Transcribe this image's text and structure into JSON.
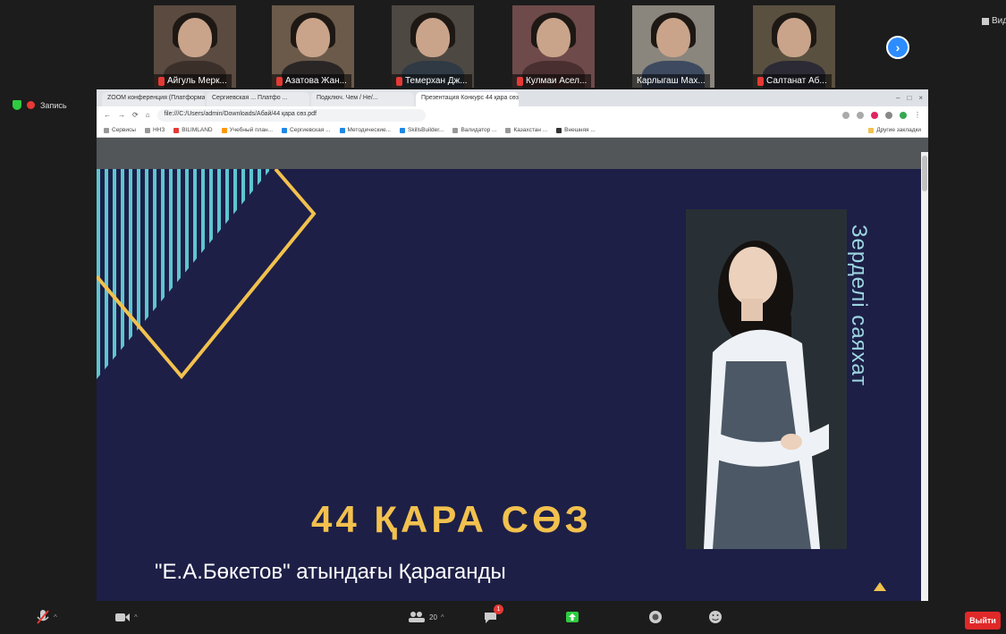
{
  "participants": [
    {
      "name": "Айгуль Мерк..."
    },
    {
      "name": "Азатова Жан..."
    },
    {
      "name": "Темерхан Дж..."
    },
    {
      "name": "Кулмаи Асел..."
    },
    {
      "name": "Карлыгаш Мах..."
    },
    {
      "name": "Салтанат Аб..."
    }
  ],
  "view_label": "Вид",
  "recording": {
    "label": "Запись"
  },
  "browser": {
    "tabs": [
      {
        "label": "ZOOM конференция (Платформа ...)"
      },
      {
        "label": "Сергиевская ... Платфо ..."
      },
      {
        "label": "Подключ. Чем / Не/..."
      },
      {
        "label": "Презентация Конкурс 44 қара сөз..."
      }
    ],
    "address": "file:///C:/Users/admin/Downloads/Абай/44 қара сөз.pdf",
    "bookmarks": [
      "Сервисы",
      "ННЗ",
      "BILIMLAND",
      "Учебный план...",
      "Сергиевская ...",
      "Методические...",
      "SkillsBuilder...",
      "Валидатор ...",
      "Казахстан ...",
      "Внешняя ..."
    ],
    "other_bookmarks": "Другие закладки"
  },
  "slide": {
    "vertical_title": "Зерделі саяхат",
    "title": "44 ҚАРА СӨЗ",
    "subtitle": "\"Е.А.Бөкетов\" атындағы Қараганды"
  },
  "toolbar": {
    "participants_count": "20",
    "chat_badge": "1"
  },
  "end_label": "Выйти",
  "colors": {
    "slide_bg": "#1d1f47",
    "accent_gold": "#f2c14e",
    "accent_teal": "#5ec5d1",
    "zoom_blue": "#2d8cff",
    "end_red": "#e02828"
  }
}
